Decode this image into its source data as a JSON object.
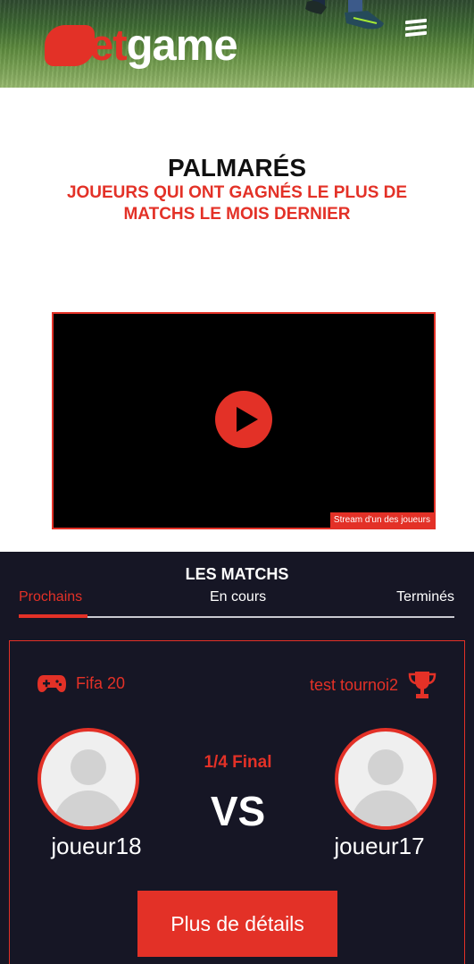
{
  "header": {
    "logo_letter": "B",
    "logo_red": "et",
    "logo_white": "game",
    "menu_icon": "hamburger-menu-icon"
  },
  "palmares": {
    "title": "PALMARÉS",
    "subtitle": "JOUEURS QUI ONT GAGNÉS LE PLUS DE MATCHS LE MOIS DERNIER"
  },
  "video": {
    "play_icon": "play-icon",
    "caption": "Stream d'un des joueurs"
  },
  "matches": {
    "title": "LES MATCHS",
    "tabs": [
      {
        "label": "Prochains",
        "active": true
      },
      {
        "label": "En cours",
        "active": false
      },
      {
        "label": "Terminés",
        "active": false
      }
    ],
    "card": {
      "game": "Fifa 20",
      "game_icon": "gamepad-icon",
      "tournament": "test tournoi2",
      "tournament_icon": "trophy-icon",
      "round": "1/4 Final",
      "vs": "VS",
      "player1": "joueur18",
      "player2": "joueur17",
      "details_button": "Plus de détails"
    }
  },
  "colors": {
    "accent": "#e33127",
    "dark_bg": "#161625"
  }
}
